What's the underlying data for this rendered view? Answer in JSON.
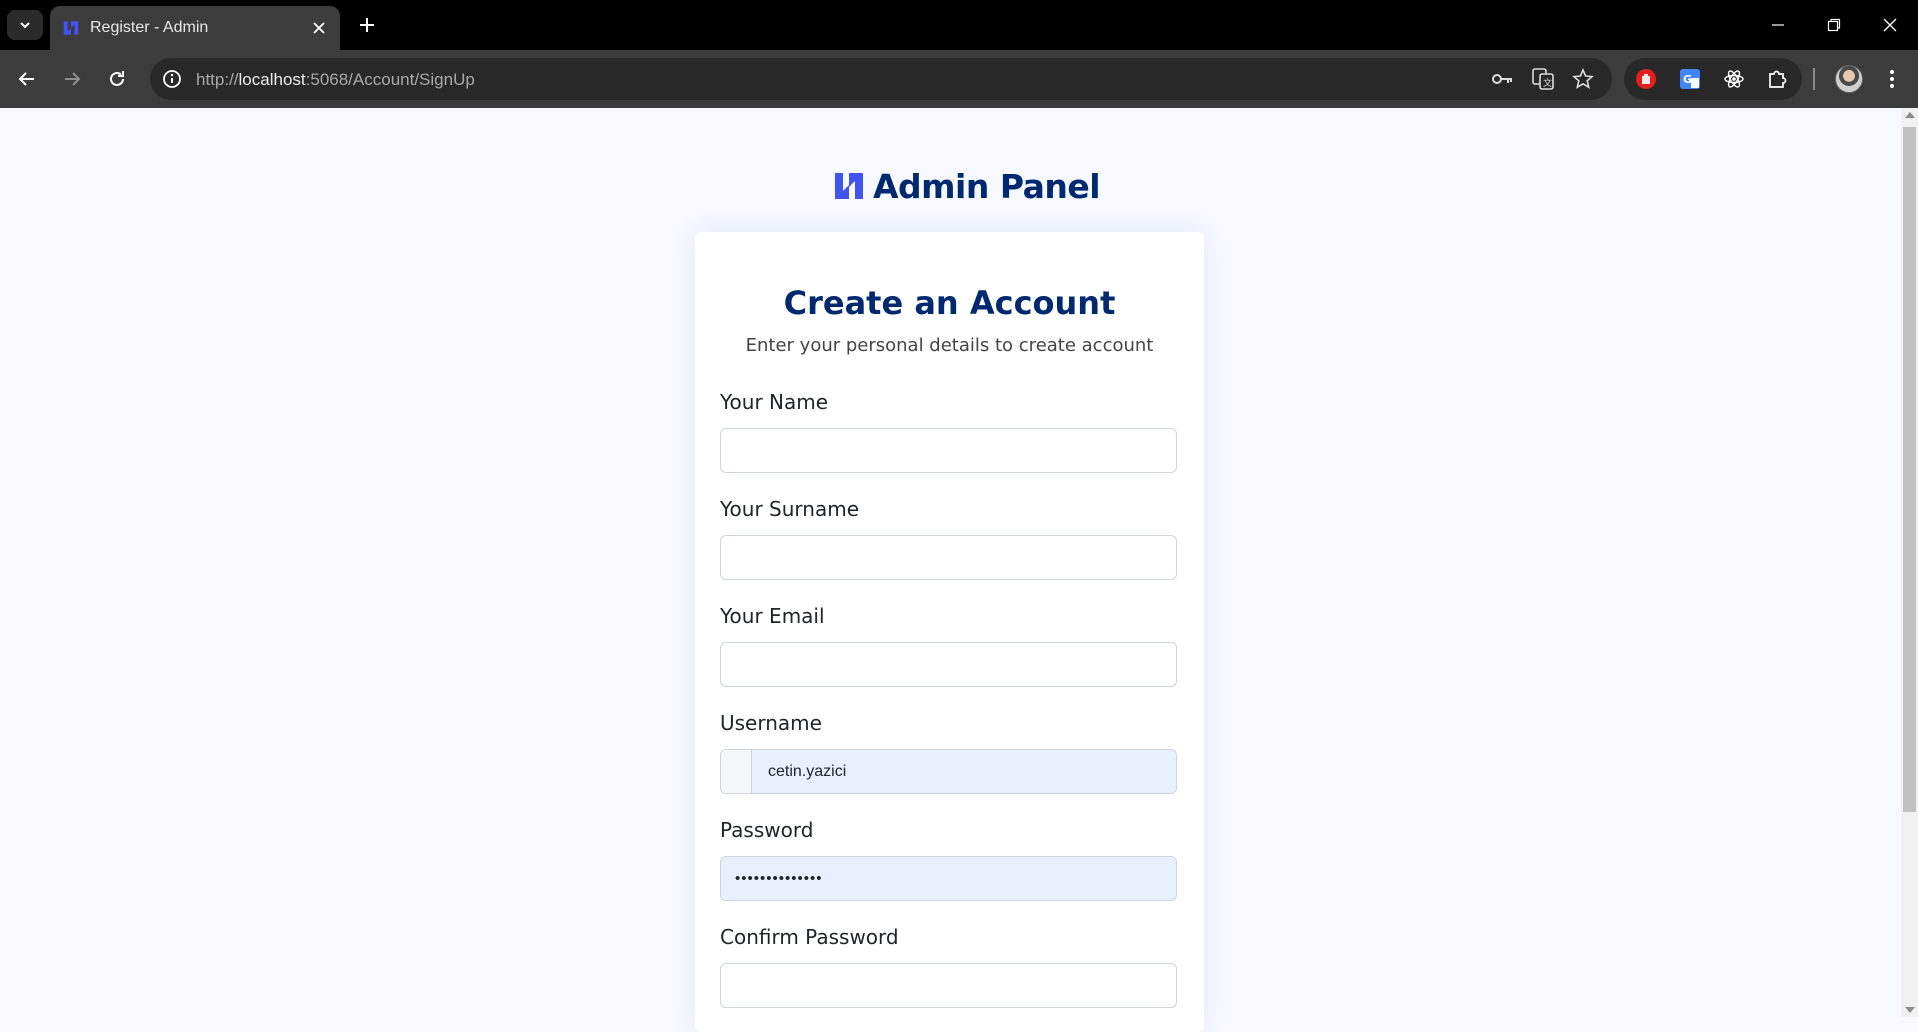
{
  "browser": {
    "tab_title": "Register - Admin",
    "url_scheme": "http://",
    "url_host": "localhost",
    "url_rest": ":5068/Account/SignUp"
  },
  "page": {
    "brand": "Admin Panel",
    "title": "Create an Account",
    "subtitle": "Enter your personal details to create account",
    "fields": {
      "name": {
        "label": "Your Name",
        "value": ""
      },
      "surname": {
        "label": "Your Surname",
        "value": ""
      },
      "email": {
        "label": "Your Email",
        "value": ""
      },
      "username": {
        "label": "Username",
        "value": "cetin.yazici"
      },
      "password": {
        "label": "Password",
        "value": "••••••••••••••"
      },
      "confirm_password": {
        "label": "Confirm Password",
        "value": ""
      }
    }
  },
  "colors": {
    "brand": "#012970",
    "logo": "#4154f1",
    "autofill": "#e8f0fe",
    "page_bg": "#f6f9ff"
  }
}
